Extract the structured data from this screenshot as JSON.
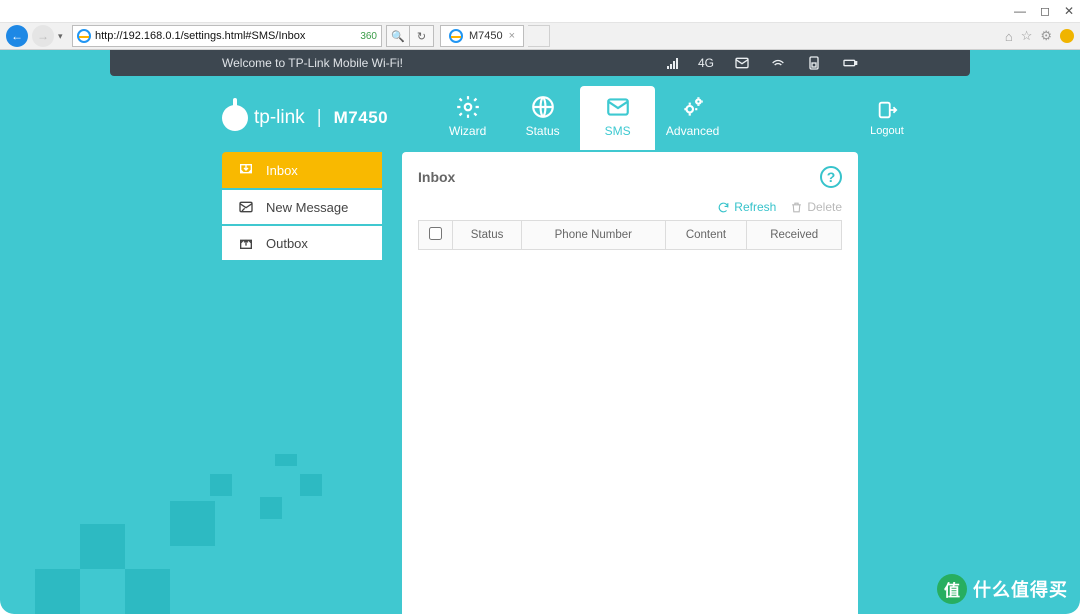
{
  "browser": {
    "url": "http://192.168.0.1/settings.html#SMS/Inbox",
    "tab_title": "M7450",
    "search_hint": "360"
  },
  "welcome": {
    "text": "Welcome to TP-Link Mobile Wi-Fi!",
    "network": "4G"
  },
  "logo": {
    "brand": "tp-link",
    "model": "M7450"
  },
  "nav": {
    "items": [
      {
        "label": "Wizard"
      },
      {
        "label": "Status"
      },
      {
        "label": "SMS"
      },
      {
        "label": "Advanced"
      }
    ],
    "logout": "Logout"
  },
  "sidebar": {
    "items": [
      {
        "label": "Inbox"
      },
      {
        "label": "New Message"
      },
      {
        "label": "Outbox"
      }
    ]
  },
  "panel": {
    "title": "Inbox",
    "refresh": "Refresh",
    "delete": "Delete",
    "columns": [
      "Status",
      "Phone Number",
      "Content",
      "Received"
    ]
  },
  "watermark": {
    "badge": "值",
    "text": "什么值得买"
  }
}
